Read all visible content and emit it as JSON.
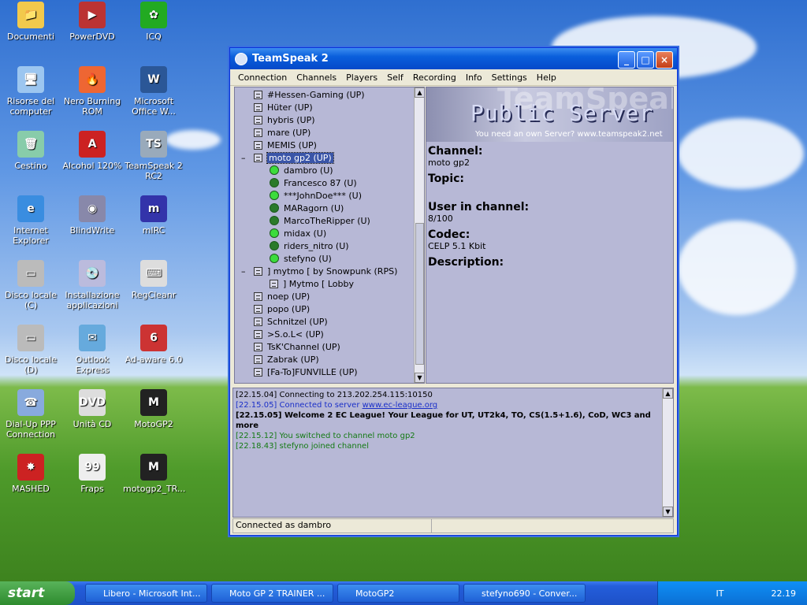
{
  "desktop": {
    "icons": [
      {
        "label": "Documenti",
        "color": "#f2c94c",
        "glyph": "📁"
      },
      {
        "label": "PowerDVD",
        "color": "#b33",
        "glyph": "▶"
      },
      {
        "label": "ICQ",
        "color": "#2a2",
        "glyph": "✿"
      },
      {
        "label": "Risorse del computer",
        "color": "#9cc6f0",
        "glyph": "🖥"
      },
      {
        "label": "Nero Burning ROM",
        "color": "#e63",
        "glyph": "🔥"
      },
      {
        "label": "Microsoft Office W...",
        "color": "#2b5797",
        "glyph": "W"
      },
      {
        "label": "Cestino",
        "color": "#8ca",
        "glyph": "🗑"
      },
      {
        "label": "Alcohol 120%",
        "color": "#c22",
        "glyph": "A"
      },
      {
        "label": "TeamSpeak 2 RC2",
        "color": "#9ab",
        "glyph": "TS"
      },
      {
        "label": "Internet Explorer",
        "color": "#3a8de0",
        "glyph": "e"
      },
      {
        "label": "BlindWrite",
        "color": "#88a",
        "glyph": "◉"
      },
      {
        "label": "mIRC",
        "color": "#33a",
        "glyph": "m"
      },
      {
        "label": "Disco locale (C)",
        "color": "#bbb",
        "glyph": "▭"
      },
      {
        "label": "Installazione applicazioni",
        "color": "#bbd",
        "glyph": "💿"
      },
      {
        "label": "RegCleanr",
        "color": "#ddd",
        "glyph": "⌨"
      },
      {
        "label": "Disco locale (D)",
        "color": "#bbb",
        "glyph": "▭"
      },
      {
        "label": "Outlook Express",
        "color": "#6ad",
        "glyph": "✉"
      },
      {
        "label": "Ad-aware 6.0",
        "color": "#c33",
        "glyph": "6"
      },
      {
        "label": "Dial-Up PPP Connection",
        "color": "#8ad",
        "glyph": "☎"
      },
      {
        "label": "Unità CD",
        "color": "#ddd",
        "glyph": "DVD"
      },
      {
        "label": "MotoGP2",
        "color": "#222",
        "glyph": "M"
      },
      {
        "label": "MASHED",
        "color": "#c22",
        "glyph": "✸"
      },
      {
        "label": "Fraps",
        "color": "#eee",
        "glyph": "99"
      },
      {
        "label": "motogp2_TR...",
        "color": "#222",
        "glyph": "M"
      }
    ]
  },
  "window": {
    "title": "TeamSpeak 2",
    "controls": {
      "min": "_",
      "max": "□",
      "close": "×"
    }
  },
  "menu": [
    "Connection",
    "Channels",
    "Players",
    "Self",
    "Recording",
    "Info",
    "Settings",
    "Help"
  ],
  "tree": [
    {
      "kind": "channel",
      "text": "#Hessen-Gaming   (UP)"
    },
    {
      "kind": "channel",
      "text": "Hüter   (UP)"
    },
    {
      "kind": "channel",
      "text": "hybris   (UP)"
    },
    {
      "kind": "channel",
      "text": "mare   (UP)"
    },
    {
      "kind": "channel",
      "text": "MEMIS   (UP)"
    },
    {
      "kind": "channel",
      "text": "moto gp2   (UP)",
      "selected": true,
      "expanded": true
    },
    {
      "kind": "user",
      "text": "dambro   (U)",
      "status": "#3cdc3c"
    },
    {
      "kind": "user",
      "text": "Francesco 87   (U)",
      "status": "#2a7a2a"
    },
    {
      "kind": "user",
      "text": "***JohnDoe***   (U)",
      "status": "#3cdc3c"
    },
    {
      "kind": "user",
      "text": "MARagorn   (U)",
      "status": "#2a7a2a"
    },
    {
      "kind": "user",
      "text": "MarcoTheRipper   (U)",
      "status": "#2a7a2a"
    },
    {
      "kind": "user",
      "text": "midax   (U)",
      "status": "#3cdc3c"
    },
    {
      "kind": "user",
      "text": "riders_nitro   (U)",
      "status": "#2a7a2a"
    },
    {
      "kind": "user",
      "text": "stefyno   (U)",
      "status": "#3cdc3c"
    },
    {
      "kind": "channel",
      "text": "] mytmo [ by Snowpunk   (RPS)",
      "expanded": true
    },
    {
      "kind": "subchannel",
      "text": "] Mytmo [ Lobby"
    },
    {
      "kind": "channel",
      "text": "noep   (UP)"
    },
    {
      "kind": "channel",
      "text": "popo   (UP)"
    },
    {
      "kind": "channel",
      "text": "Schnitzel   (UP)"
    },
    {
      "kind": "channel",
      "text": ">S.o.L<   (UP)"
    },
    {
      "kind": "channel",
      "text": "TsK'Channel   (UP)"
    },
    {
      "kind": "channel",
      "text": "Zabrak   (UP)"
    },
    {
      "kind": "channel",
      "text": "[Fa-To]FUNVILLE   (UP)"
    }
  ],
  "banner": {
    "bg_word": "TeamSpeak",
    "main": "Public Server",
    "sub": "You need an own Server?  www.teamspeak2.net"
  },
  "info": {
    "channel_label": "Channel:",
    "channel": "moto gp2",
    "topic_label": "Topic:",
    "topic": "",
    "users_label": "User in channel:",
    "users": "8/100",
    "codec_label": "Codec:",
    "codec": "CELP 5.1 Kbit",
    "desc_label": "Description:"
  },
  "log": [
    {
      "time": "[22.15.04]",
      "text": "Connecting to 213.202.254.115:10150",
      "color": "#000000",
      "bold": false
    },
    {
      "time": "[22.15.05]",
      "text": "Connected to server ",
      "link": "www.ec-league.org",
      "color": "#1a2fc8",
      "bold": false
    },
    {
      "time": "[22.15.05]",
      "text": "Welcome 2 EC League! Your League for UT, UT2k4, TO, CS(1.5+1.6), CoD, WC3 and more",
      "color": "#000000",
      "bold": true
    },
    {
      "time": "[22.15.12]",
      "text": "You switched to channel moto gp2",
      "color": "#147a14",
      "bold": false
    },
    {
      "time": "[22.18.43]",
      "text": "stefyno joined channel",
      "color": "#147a14",
      "bold": false
    }
  ],
  "status": {
    "text": "Connected as dambro"
  },
  "taskbar": {
    "start": "start",
    "tasks": [
      "Libero - Microsoft Int...",
      "Moto GP 2 TRAINER ...",
      "MotoGP2",
      "stefyno690 - Conver..."
    ],
    "lang": "IT",
    "clock": "22.19"
  }
}
